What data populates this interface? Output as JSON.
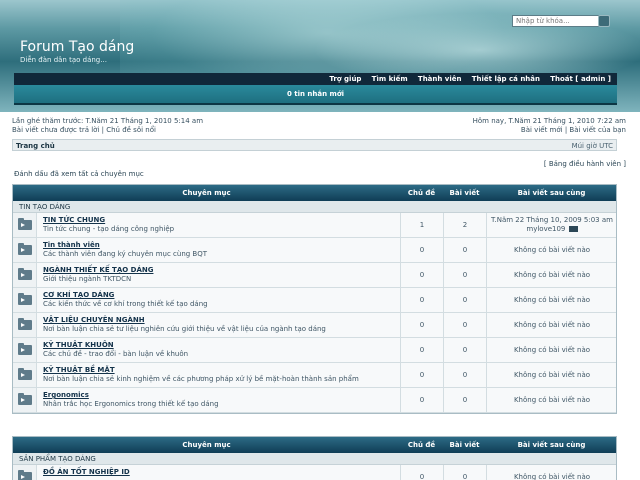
{
  "header": {
    "title": "Forum Tạo dáng",
    "description": "Diễn đàn dân tạo dáng...",
    "search_placeholder": "Nhập từ khóa..."
  },
  "nav": {
    "items": [
      "Trợ giúp",
      "Tìm kiếm",
      "Thành viên",
      "Thiết lập cá nhân",
      "Thoát [ admin ]"
    ]
  },
  "messages": {
    "label": "0 tin nhắn mới"
  },
  "info": {
    "last_visit": "Lần ghé thăm trước: T.Năm 21 Tháng 1, 2010 5:14 am",
    "unanswered": "Bài viết chưa được trả lời | Chủ đề sôi nổi",
    "now": "Hôm nay, T.Năm 21 Tháng 1, 2010 7:22 am",
    "new_posts": "Bài viết mới | Bài viết của bạn"
  },
  "breadcrumb": {
    "home": "Trang chủ",
    "timezone": "Múi giờ UTC"
  },
  "admin_link": "[ Bảng điều hành viên ]",
  "mark_read": "Đánh dấu đã xem tất cả chuyên mục",
  "table_headers": {
    "forum": "Chuyên mục",
    "topics": "Chủ đề",
    "posts": "Bài viết",
    "last_post": "Bài viết sau cùng"
  },
  "sections": [
    {
      "category": "TIN TẠO DÁNG",
      "forums": [
        {
          "name": "TIN TỨC CHUNG",
          "desc": "Tin tức chung - tạo dáng công nghiệp",
          "topics": "1",
          "posts": "2",
          "last_line1": "T.Năm 22 Tháng 10, 2009 5:03 am",
          "last_line2": "mylove109"
        },
        {
          "name": "Tin thành viên",
          "desc": "Các thành viên đang ký chuyên mục cùng BQT",
          "topics": "0",
          "posts": "0",
          "last": "Không có bài viết nào"
        },
        {
          "name": "NGÀNH THIẾT KẾ TẠO DÁNG",
          "desc": "Giới thiệu ngành TKTDCN",
          "topics": "0",
          "posts": "0",
          "last": "Không có bài viết nào"
        },
        {
          "name": "CƠ KHÍ TẠO DÁNG",
          "desc": "Các kiến thức về cơ khí trong thiết kế tạo dáng",
          "topics": "0",
          "posts": "0",
          "last": "Không có bài viết nào"
        },
        {
          "name": "VẬT LIỆU CHUYÊN NGÀNH",
          "desc": "Nơi bàn luận chia sẻ tư liệu nghiên cứu giới thiệu về vật liệu của ngành tạo dáng",
          "topics": "0",
          "posts": "0",
          "last": "Không có bài viết nào"
        },
        {
          "name": "KỸ THUẬT KHUÔN",
          "desc": "Các chủ đề - trao đổi - bàn luận về khuôn",
          "topics": "0",
          "posts": "0",
          "last": "Không có bài viết nào"
        },
        {
          "name": "KỸ THUẬT BỀ MẶT",
          "desc": "Nơi bàn luận chia sẻ kinh nghiệm về các phương pháp xử lý bề mặt-hoàn thành sản phẩm",
          "topics": "0",
          "posts": "0",
          "last": "Không có bài viết nào"
        },
        {
          "name": "Ergonomics",
          "desc": "Nhân trắc học Ergonomics trong thiết kế tạo dáng",
          "topics": "0",
          "posts": "0",
          "last": "Không có bài viết nào"
        }
      ]
    },
    {
      "category": "SẢN PHẨM TẠO DÁNG",
      "forums": [
        {
          "name": "ĐỒ ÁN TỐT NGHIỆP ID",
          "desc": "",
          "topics": "0",
          "posts": "0",
          "last": "Không có bài viết nào"
        }
      ]
    }
  ]
}
